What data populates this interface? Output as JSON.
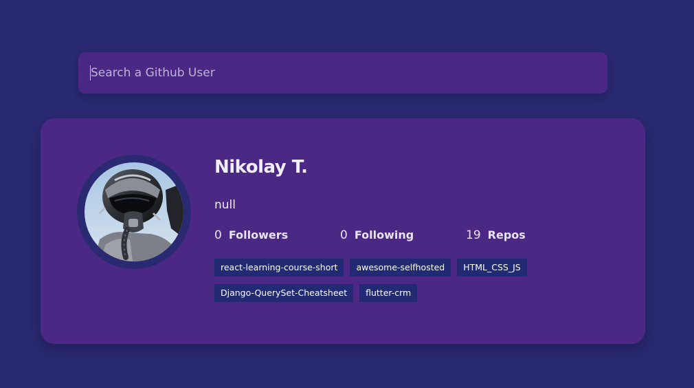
{
  "search": {
    "placeholder": "Search a Github User",
    "value": ""
  },
  "profile": {
    "name": "Nikolay T.",
    "bio": "null",
    "avatar": "pilot-helmet-avatar",
    "stats": {
      "followers": {
        "count": "0",
        "label": "Followers"
      },
      "following": {
        "count": "0",
        "label": "Following"
      },
      "repos": {
        "count": "19",
        "label": "Repos"
      }
    },
    "repos": [
      "react-learning-course-short",
      "awesome-selfhosted",
      "HTML_CSS_JS",
      "Django-QuerySet-Cheatsheet",
      "flutter-crm"
    ]
  },
  "colors": {
    "background": "#2a2a72",
    "card": "#4c2885",
    "repo_tag": "#212a72",
    "text": "#eeeeff"
  }
}
